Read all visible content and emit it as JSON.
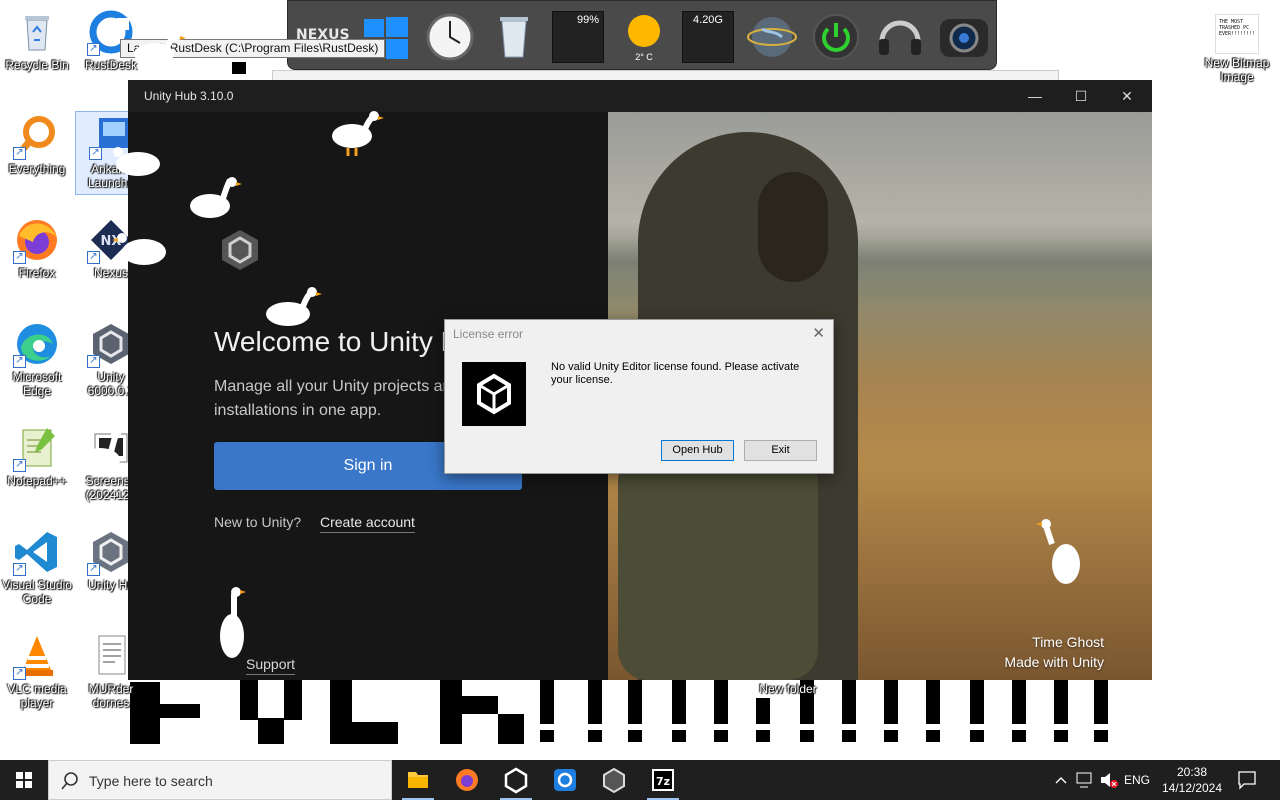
{
  "tooltip": {
    "text": "Launch RustDesk (C:\\Program Files\\RustDesk)"
  },
  "desktop_icons": [
    {
      "label": "Recycle Bin",
      "icon": "recycle-bin-icon"
    },
    {
      "label": "RustDesk",
      "icon": "rustdesk-icon"
    },
    {
      "label": "Everything",
      "icon": "search-magnifier-icon"
    },
    {
      "label": "Ankama\nLauncher",
      "icon": "ankama-launcher-icon"
    },
    {
      "label": "Firefox",
      "icon": "firefox-icon"
    },
    {
      "label": "Nexus",
      "icon": "nexus-icon"
    },
    {
      "label": "Microsoft\nEdge",
      "icon": "edge-icon"
    },
    {
      "label": "Unity\n6000.0.2",
      "icon": "unity-icon"
    },
    {
      "label": "Notepad++",
      "icon": "notepadpp-icon"
    },
    {
      "label": "Screensh\n(2024121",
      "icon": "screenshot-icon"
    },
    {
      "label": "Visual Studio\nCode",
      "icon": "vscode-icon"
    },
    {
      "label": "Unity Hu",
      "icon": "unity-hub-icon"
    },
    {
      "label": "VLC media\nplayer",
      "icon": "vlc-icon"
    },
    {
      "label": "MURder\ndornes",
      "icon": "text-file-icon"
    },
    {
      "label": "New Bitmap\nImage",
      "icon": "bitmap-icon"
    },
    {
      "label": "New folder",
      "icon": "folder-icon"
    }
  ],
  "bitmap_thumb_text": "THE MOST TRASHED PC EVER!!!!!!!!",
  "dock": {
    "logo": "NEXUS",
    "cpu": "99%",
    "weather": "2° C",
    "disk": "4.20G"
  },
  "unity_window": {
    "title": "Unity Hub 3.10.0",
    "welcome": "Welcome to Unity Hub",
    "subtitle": "Manage all your Unity projects and editor installations in one app.",
    "sign_in": "Sign in",
    "new_to": "New to Unity?",
    "create_account": "Create account",
    "support": "Support",
    "credit_title": "Time Ghost",
    "credit_sub": "Made with Unity"
  },
  "dialog": {
    "title": "License error",
    "message": "No valid Unity Editor license found. Please activate your license.",
    "open_hub": "Open Hub",
    "exit": "Exit"
  },
  "taskbar": {
    "search_placeholder": "Type here to search",
    "lang": "ENG",
    "time": "20:38",
    "date": "14/12/2024"
  },
  "colors": {
    "accent": "#3a77c9",
    "taskbar": "#1f1f1f",
    "window_bg": "#191919"
  }
}
